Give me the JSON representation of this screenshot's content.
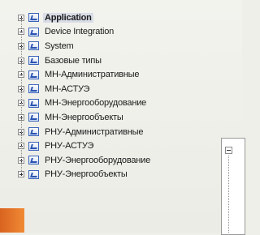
{
  "tree": {
    "items": [
      {
        "label": "Application",
        "selected": true
      },
      {
        "label": "Device Integration"
      },
      {
        "label": "System"
      },
      {
        "label": "Базовые типы"
      },
      {
        "label": "МН-Административные"
      },
      {
        "label": "МН-АСТУЭ"
      },
      {
        "label": "МН-Энергооборудование"
      },
      {
        "label": "МН-Энергообъекты"
      },
      {
        "label": "РНУ-Административные"
      },
      {
        "label": "РНУ-АСТУЭ"
      },
      {
        "label": "РНУ-Энергооборудование"
      },
      {
        "label": "РНУ-Энергообъекты"
      }
    ],
    "icon": "folder-check-icon",
    "expander_icon": "plus-box-icon",
    "selected_color": "#d8dde6"
  },
  "side_panel": {
    "expander_icon": "minus-box-icon"
  }
}
